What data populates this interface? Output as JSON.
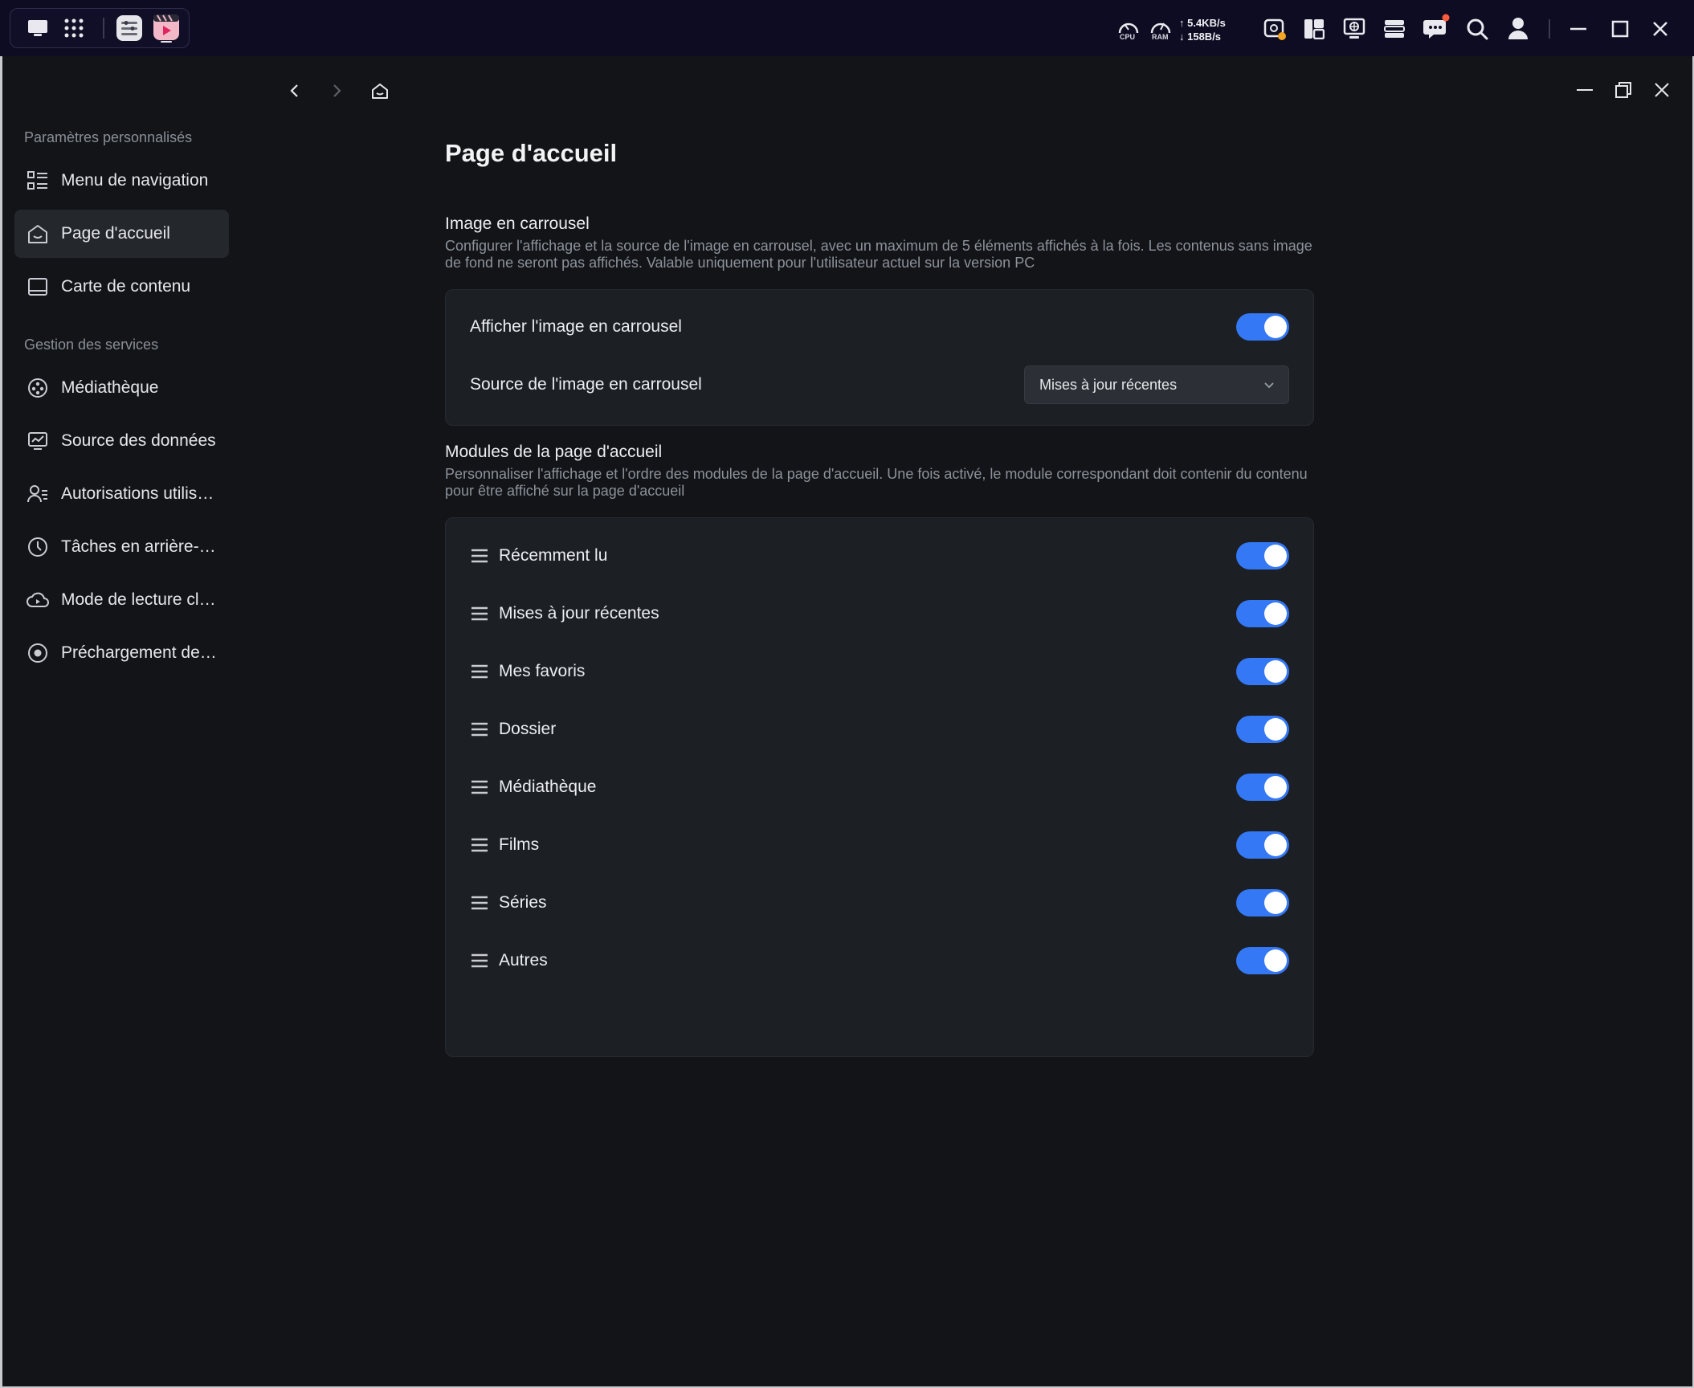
{
  "topbar": {
    "cpu_label": "CPU",
    "ram_label": "RAM",
    "upload": "↑ 5.4KB/s",
    "download": "↓ 158B/s",
    "icons": [
      "desktop-icon",
      "apps-grid-icon",
      "settings-app-icon",
      "video-app-icon",
      "cpu-gauge-icon",
      "ram-gauge-icon",
      "background-tasks-icon",
      "widgets-icon",
      "remote-desktop-icon",
      "storage-icon",
      "messages-icon",
      "search-icon",
      "user-icon",
      "minimize-icon",
      "maximize-icon",
      "close-icon"
    ],
    "notification_color": "#ff5a3c"
  },
  "sidebar": {
    "section1": "Paramètres personnalisés",
    "section2": "Gestion des services",
    "items": [
      {
        "label": "Menu de navigation",
        "icon": "list-icon"
      },
      {
        "label": "Page d'accueil",
        "icon": "home-icon",
        "active": true
      },
      {
        "label": "Carte de contenu",
        "icon": "card-icon"
      },
      {
        "label": "Médiathèque",
        "icon": "media-library-icon"
      },
      {
        "label": "Source des données",
        "icon": "data-source-icon"
      },
      {
        "label": "Autorisations utilis…",
        "icon": "user-permissions-icon"
      },
      {
        "label": "Tâches en arrière-…",
        "icon": "clock-icon"
      },
      {
        "label": "Mode de lecture cl…",
        "icon": "cloud-play-icon"
      },
      {
        "label": "Préchargement de…",
        "icon": "preload-icon"
      }
    ]
  },
  "page": {
    "title": "Page d'accueil",
    "carousel": {
      "title": "Image en carrousel",
      "description": "Configurer l'affichage et la source de l'image en carrousel, avec un maximum de 5 éléments affichés à la fois. Les contenus sans image de fond ne seront pas affichés. Valable uniquement pour l'utilisateur actuel sur la version PC",
      "show_label": "Afficher l'image en carrousel",
      "show_enabled": true,
      "source_label": "Source de l'image en carrousel",
      "source_value": "Mises à jour récentes"
    },
    "modules": {
      "title": "Modules de la page d'accueil",
      "description": "Personnaliser l'affichage et l'ordre des modules de la page d'accueil. Une fois activé, le module correspondant doit contenir du contenu pour être affiché sur la page d'accueil",
      "items": [
        {
          "label": "Récemment lu",
          "enabled": true
        },
        {
          "label": "Mises à jour récentes",
          "enabled": true
        },
        {
          "label": "Mes favoris",
          "enabled": true
        },
        {
          "label": "Dossier",
          "enabled": true
        },
        {
          "label": "Médiathèque",
          "enabled": true
        },
        {
          "label": "Films",
          "enabled": true
        },
        {
          "label": "Séries",
          "enabled": true
        },
        {
          "label": "Autres",
          "enabled": true
        }
      ]
    }
  },
  "colors": {
    "accent": "#3478f6",
    "background": "#121417",
    "card": "#1c1f23",
    "topbar": "#0d0c22"
  }
}
